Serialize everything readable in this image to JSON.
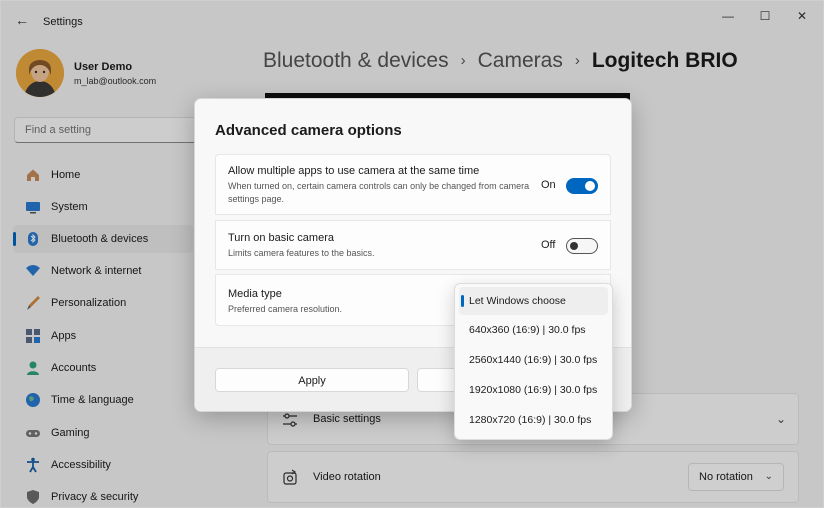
{
  "window": {
    "title": "Settings",
    "back_glyph": "←",
    "controls": {
      "minimize": "—",
      "maximize": "☐",
      "close": "✕"
    }
  },
  "user": {
    "name": "User Demo",
    "email": "m_lab@outlook.com"
  },
  "search": {
    "placeholder": "Find a setting"
  },
  "nav": [
    {
      "label": "Home",
      "icon": "home-icon",
      "active": false
    },
    {
      "label": "System",
      "icon": "system-icon",
      "active": false
    },
    {
      "label": "Bluetooth & devices",
      "icon": "bluetooth-icon",
      "active": true
    },
    {
      "label": "Network & internet",
      "icon": "network-icon",
      "active": false
    },
    {
      "label": "Personalization",
      "icon": "brush-icon",
      "active": false
    },
    {
      "label": "Apps",
      "icon": "apps-icon",
      "active": false
    },
    {
      "label": "Accounts",
      "icon": "accounts-icon",
      "active": false
    },
    {
      "label": "Time & language",
      "icon": "globe-icon",
      "active": false
    },
    {
      "label": "Gaming",
      "icon": "gaming-icon",
      "active": false
    },
    {
      "label": "Accessibility",
      "icon": "accessibility-icon",
      "active": false
    },
    {
      "label": "Privacy & security",
      "icon": "shield-icon",
      "active": false
    }
  ],
  "breadcrumb": {
    "items": [
      "Bluetooth & devices",
      "Cameras"
    ],
    "current": "Logitech BRIO",
    "separator": "›"
  },
  "background_rows": {
    "basic_settings": {
      "label": "Basic settings",
      "icon": "sliders-icon"
    },
    "video_rotation": {
      "label": "Video rotation",
      "icon": "rotate-icon",
      "value": "No rotation"
    }
  },
  "dialog": {
    "title": "Advanced camera options",
    "options": [
      {
        "title": "Allow multiple apps to use camera at the same time",
        "description": "When turned on, certain camera controls can only be changed from camera settings page.",
        "state": "On",
        "on": true
      },
      {
        "title": "Turn on basic camera",
        "description": "Limits camera features to the basics.",
        "state": "Off",
        "on": false
      },
      {
        "title": "Media type",
        "description": "Preferred camera resolution."
      }
    ],
    "apply_label": "Apply",
    "cancel_label": ""
  },
  "media_dropdown": {
    "selected_index": 0,
    "options": [
      "Let Windows choose",
      "640x360 (16:9) | 30.0 fps",
      "2560x1440 (16:9) | 30.0 fps",
      "1920x1080 (16:9) | 30.0 fps",
      "1280x720 (16:9) | 30.0 fps"
    ]
  },
  "colors": {
    "accent": "#0067c0"
  }
}
